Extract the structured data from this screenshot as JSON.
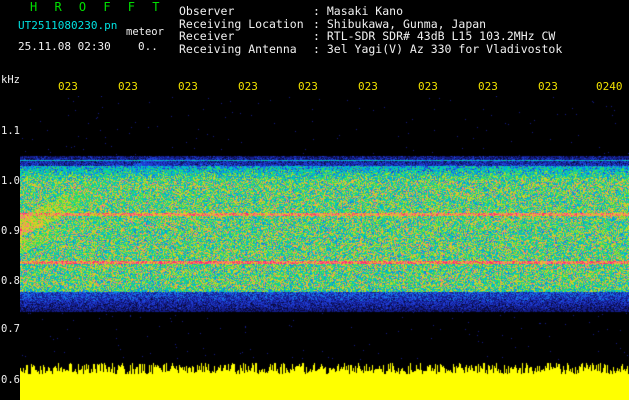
{
  "header": {
    "app_title": "H R O F F T",
    "filename": "UT2511080230.pn",
    "meteor_label": "meteor",
    "datetime": "25.11.08 02:30",
    "count": "0..",
    "fields": [
      {
        "label": "Observer",
        "value": ": Masaki Kano"
      },
      {
        "label": "Receiving Location",
        "value": ": Shibukawa, Gunma, Japan"
      },
      {
        "label": "Receiver",
        "value": ": RTL-SDR SDR# 43dB L15 103.2MHz CW"
      },
      {
        "label": "Receiving Antenna",
        "value": ": 3el Yagi(V) Az 330 for Vladivostok"
      }
    ]
  },
  "axis": {
    "unit": "kHz",
    "y_ticks": [
      "1.1",
      "1.0",
      "0.9",
      "0.8",
      "0.7",
      "0.6"
    ],
    "x_ticks": [
      "023",
      "023",
      "023",
      "023",
      "023",
      "023",
      "023",
      "023",
      "023",
      "0240"
    ]
  },
  "colors": {
    "background": "#000000",
    "title": "#00e000",
    "tick_label": "#f0e000",
    "strong_signal": "#ff2e6e",
    "yellow_band": "#ffff00"
  }
}
